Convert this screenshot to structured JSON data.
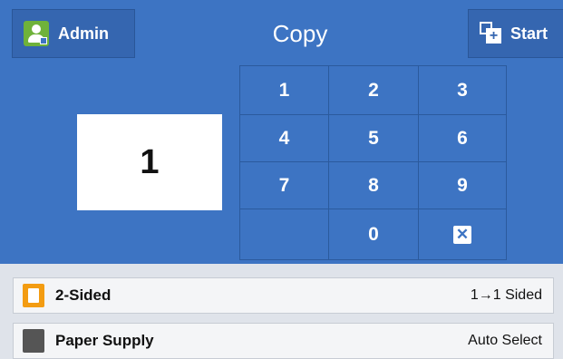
{
  "header": {
    "admin_label": "Admin",
    "title": "Copy",
    "start_label": "Start"
  },
  "display": {
    "quantity": "1"
  },
  "keypad": {
    "k1": "1",
    "k2": "2",
    "k3": "3",
    "k4": "4",
    "k5": "5",
    "k6": "6",
    "k7": "7",
    "k8": "8",
    "k9": "9",
    "k0": "0",
    "clear_glyph": "✕"
  },
  "features": {
    "two_sided": {
      "label": "2-Sided",
      "value": "1→1 Sided"
    },
    "paper_supply": {
      "label": "Paper Supply",
      "value": "Auto Select"
    }
  },
  "colors": {
    "panel_blue": "#3d74c3",
    "admin_green": "#6fb23a",
    "two_sided_orange": "#f39c12"
  },
  "icons": {
    "admin": "admin-user-icon",
    "start": "start-copy-icon",
    "clear": "clear-x-icon",
    "two_sided": "document-icon",
    "paper_supply": "paper-tray-icon"
  }
}
